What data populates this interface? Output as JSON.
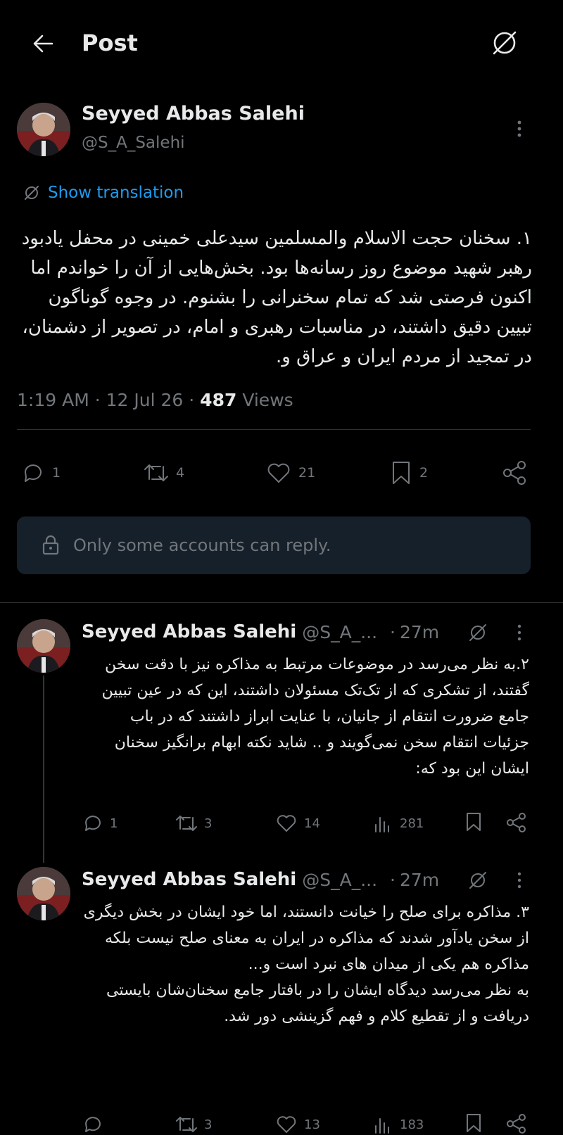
{
  "header": {
    "title": "Post"
  },
  "main_post": {
    "author_name": "Seyyed Abbas Salehi",
    "handle": "@S_A_Salehi",
    "show_translation": "Show translation",
    "text": "۱. سخنان حجت الاسلام والمسلمین سیدعلی خمینی در محفل یادبود رهبر شهید موضوع  روز رسانه‌ها بود. بخش‌هایی از آن را خواندم اما اکنون فرصتی شد که تمام سخنرانی را بشنوم. در وجوه گوناگون تبیین دقیق داشتند، در مناسبات رهبری و امام، در  تصویر از دشمنان، در تمجید از مردم ایران و عراق و.",
    "time": "1:19 AM",
    "date": "12 Jul 26",
    "views_count": "487",
    "views_label": "Views",
    "stats": {
      "replies": "1",
      "reposts": "4",
      "likes": "21",
      "bookmarks": "2"
    }
  },
  "reply_restriction": {
    "text": "Only some accounts can reply."
  },
  "thread": [
    {
      "author_name": "Seyyed Abbas Salehi",
      "handle": "@S_A_...",
      "time": "27m",
      "text": "۲.به نظر می‌رسد در موضوعات مرتبط به مذاکره نیز با دقت سخن گفتند، از تشکری که از تک‌تک مسئولان داشتند،  این که در عین  تبیین جامع ضرورت انتقام از جانیان، با عنایت ابراز داشتند که  در باب جزئیات انتقام سخن نمی‌گویند و .. شاید نکته ابهام برانگیز سخنان ایشان این بود که:",
      "stats": {
        "replies": "1",
        "reposts": "3",
        "likes": "14",
        "views": "281"
      }
    },
    {
      "author_name": "Seyyed Abbas Salehi",
      "handle": "@S_A_...",
      "time": "27m",
      "text_lines": [
        "۳. مذاکره برای صلح را خیانت دانستند، اما خود ایشان در بخش دیگری از سخن یادآور شدند که مذاکره در ایران به معنای صلح نیست بلکه مذاکره هم یکی از میدان های نبرد است و...",
        "به نظر می‌رسد دیدگاه ایشان را در بافتار جامع سخنان‌شان بایستی دریافت و از تقطیع  کلام و فهم گزینشی دور شد."
      ],
      "stats": {
        "replies": "",
        "reposts": "3",
        "likes": "13",
        "views": "183"
      }
    }
  ],
  "colors": {
    "background": "#000000",
    "text": "#e7e9ea",
    "secondary": "#71767b",
    "link": "#1d9bf0",
    "restriction_bg": "#16202a",
    "divider": "#2f3336"
  }
}
